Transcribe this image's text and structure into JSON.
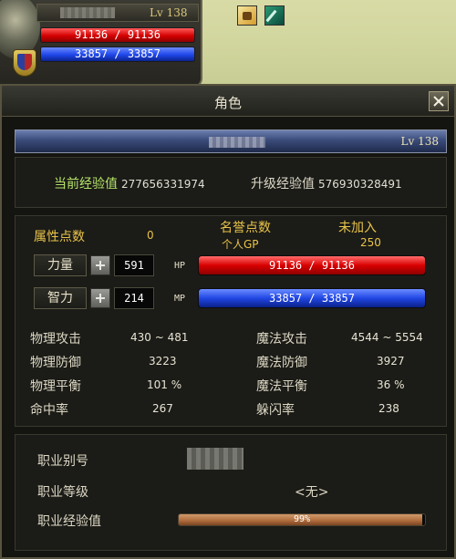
{
  "hud": {
    "level": "Lv 138",
    "hp": "91136 / 91136",
    "mp": "33857 / 33857"
  },
  "window": {
    "title": "角色",
    "level": "Lv 138"
  },
  "exp": {
    "current_label": "当前经验值",
    "current_value": "277656331974",
    "next_label": "升级经验值",
    "next_value": "576930328491"
  },
  "attributes": {
    "points_label": "属性点数",
    "points_value": "0",
    "honor_label": "名誉点数",
    "honor_status": "未加入",
    "gp_label": "个人GP",
    "gp_value": "250",
    "str_label": "力量",
    "str_value": "591",
    "int_label": "智力",
    "int_value": "214",
    "hp_tag": "HP",
    "mp_tag": "MP",
    "hp": "91136 / 91136",
    "mp": "33857 / 33857"
  },
  "combat": {
    "rows": [
      {
        "label": "物理攻击",
        "value": "430 ~ 481",
        "label2": "魔法攻击",
        "value2": "4544 ~ 5554"
      },
      {
        "label": "物理防御",
        "value": "3223",
        "label2": "魔法防御",
        "value2": "3927"
      },
      {
        "label": "物理平衡",
        "value": "101 %",
        "label2": "魔法平衡",
        "value2": "36 %"
      },
      {
        "label": "命中率",
        "value": "267",
        "label2": "躲闪率",
        "value2": "238"
      }
    ]
  },
  "job": {
    "alias_label": "职业别号",
    "grade_label": "职业等级",
    "grade_value": "<无>",
    "exp_label": "职业经验值",
    "exp_text": "99%",
    "exp_fraction": 0.99
  },
  "icons": {
    "close": "close-icon",
    "plus": "plus-icon",
    "buff_a": "buff-icon",
    "buff_b": "sword-buff-icon"
  },
  "colors": {
    "hp": "#d40000",
    "mp": "#1e45e8",
    "gold": "#e8c34a",
    "green": "#b6e46a"
  }
}
